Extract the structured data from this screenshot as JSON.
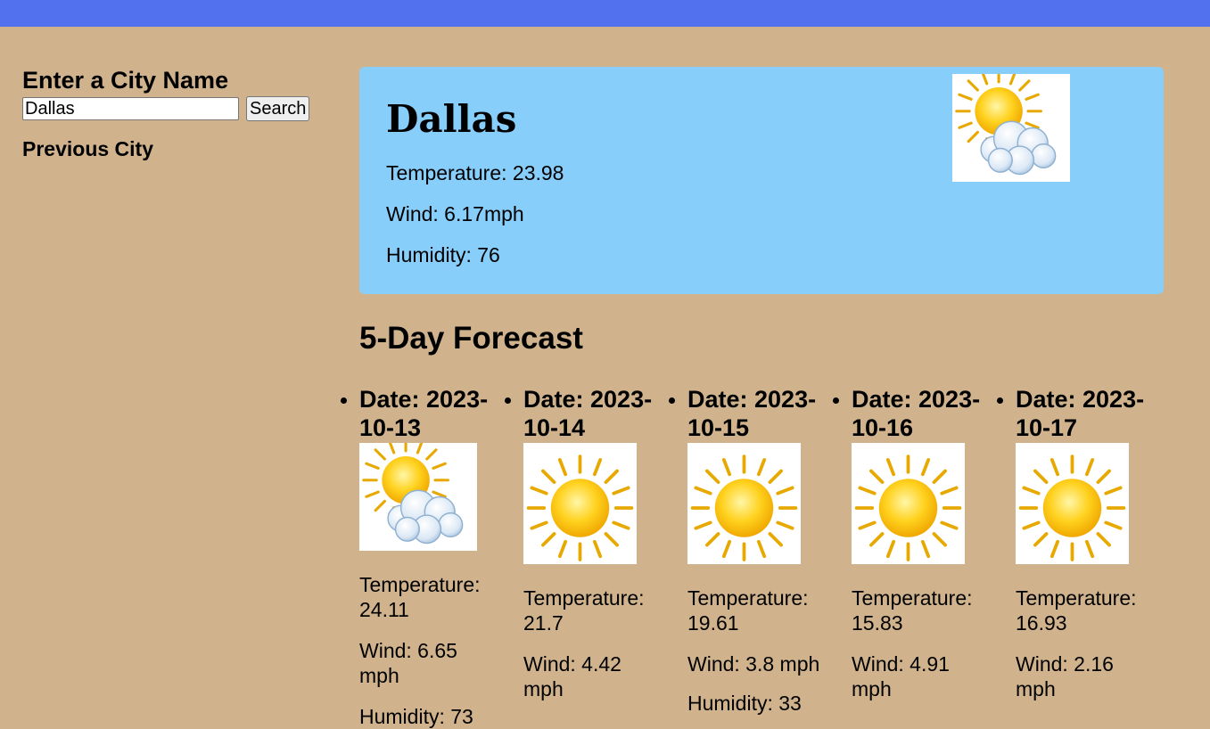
{
  "search": {
    "heading": "Enter a City Name",
    "input_value": "Dallas",
    "button_label": "Search",
    "previous_heading": "Previous City"
  },
  "current": {
    "city": "Dallas",
    "temperature": "Temperature: 23.98",
    "wind": "Wind: 6.17mph",
    "humidity": "Humidity: 76",
    "icon": "partly-cloudy-icon"
  },
  "forecast": {
    "title": "5-Day Forecast",
    "days": [
      {
        "date": "Date: 2023-10-13",
        "icon": "partly-cloudy-icon",
        "temp_label": "Temperature:",
        "temp": "24.11",
        "wind_label": "Wind: 6.65",
        "wind_unit": "mph",
        "humidity": "Humidity: 73"
      },
      {
        "date": "Date: 2023-10-14",
        "icon": "sun-icon",
        "temp_label": "Temperature:",
        "temp": "21.7",
        "wind_label": "Wind: 4.42",
        "wind_unit": "mph",
        "humidity": ""
      },
      {
        "date": "Date: 2023-10-15",
        "icon": "sun-icon",
        "temp_label": "Temperature:",
        "temp": "19.61",
        "wind_label": "Wind: 3.8 mph",
        "wind_unit": "",
        "humidity": "Humidity: 33"
      },
      {
        "date": "Date: 2023-10-16",
        "icon": "sun-icon",
        "temp_label": "Temperature:",
        "temp": "15.83",
        "wind_label": "Wind: 4.91",
        "wind_unit": "mph",
        "humidity": ""
      },
      {
        "date": "Date: 2023-10-17",
        "icon": "sun-icon",
        "temp_label": "Temperature:",
        "temp": "16.93",
        "wind_label": "Wind: 2.16",
        "wind_unit": "mph",
        "humidity": ""
      }
    ]
  },
  "colors": {
    "topbar": "#5271ef",
    "background": "#d0b38d",
    "current_card": "#87cefa"
  }
}
